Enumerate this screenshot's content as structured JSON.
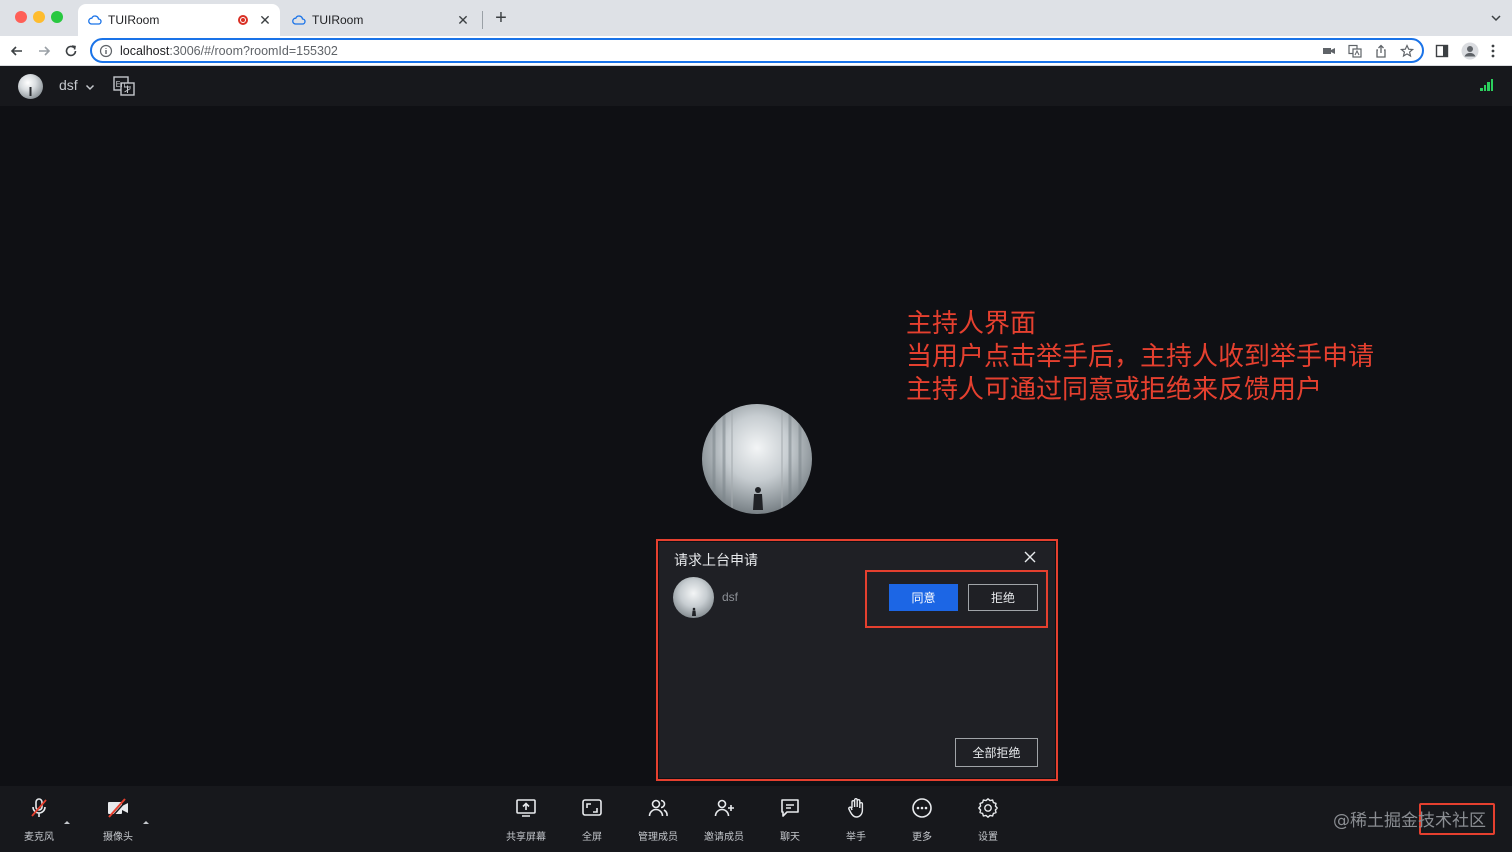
{
  "browser": {
    "tabs": [
      {
        "title": "TUIRoom",
        "active": true,
        "recording": true
      },
      {
        "title": "TUIRoom",
        "active": false,
        "recording": false
      }
    ],
    "url_host": "localhost",
    "url_path": ":3006/#/room?roomId=155302"
  },
  "header": {
    "user_name": "dsf",
    "language_icon": "en-zh-translate-icon",
    "signal_icon": "network-signal-icon"
  },
  "annotation": {
    "line1": "主持人界面",
    "line2": "当用户点击举手后，主持人收到举手申请",
    "line3": "主持人可通过同意或拒绝来反馈用户"
  },
  "dialog": {
    "title": "请求上台申请",
    "user_name": "dsf",
    "agree_label": "同意",
    "reject_label": "拒绝",
    "reject_all_label": "全部拒绝"
  },
  "footer": {
    "mic_label": "麦克风",
    "camera_label": "摄像头",
    "share_label": "共享屏幕",
    "fullscreen_label": "全屏",
    "manage_label": "管理成员",
    "invite_label": "邀请成员",
    "chat_label": "聊天",
    "raise_hand_label": "举手",
    "more_label": "更多",
    "settings_label": "设置",
    "watermark": "@稀土掘金技术社区"
  },
  "colors": {
    "accent": "#1c66e5",
    "annotation": "#e5402f",
    "background": "#0f1014",
    "panel": "#1f2025"
  }
}
